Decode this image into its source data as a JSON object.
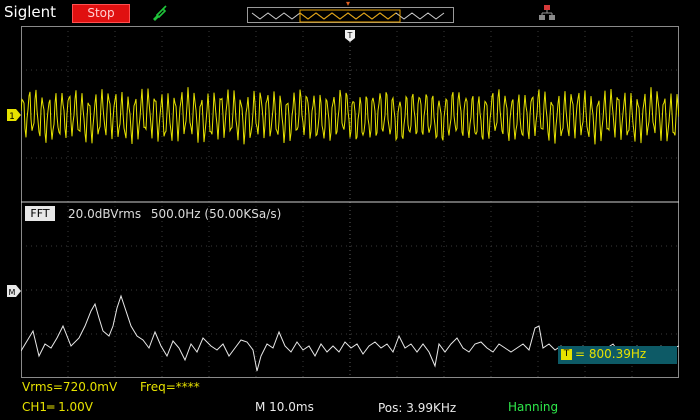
{
  "header": {
    "brand": "Siglent",
    "run_state": "Stop",
    "run_state_color": "#e01010"
  },
  "icons": {
    "probe": "probe-icon",
    "network": "network-icon",
    "trigger": "trigger-marker-icon"
  },
  "trigger": {
    "marker_glyph": "T"
  },
  "channel1": {
    "marker": "1",
    "color": "#e6e200"
  },
  "math": {
    "marker": "M",
    "color": "#ffffff"
  },
  "fft": {
    "label": "FFT",
    "scale": "20.0dBVrms",
    "span": "500.0Hz (50.00KSa/s)",
    "window": "Hanning"
  },
  "cursor": {
    "badge": "T",
    "readout": "= 800.39Hz"
  },
  "measurements": {
    "vrms": "Vrms=720.0mV",
    "freq": "Freq=****"
  },
  "status": {
    "ch1": "CH1═ 1.00V",
    "timebase": "M 10.0ms",
    "position": "Pos: 3.99KHz"
  }
}
